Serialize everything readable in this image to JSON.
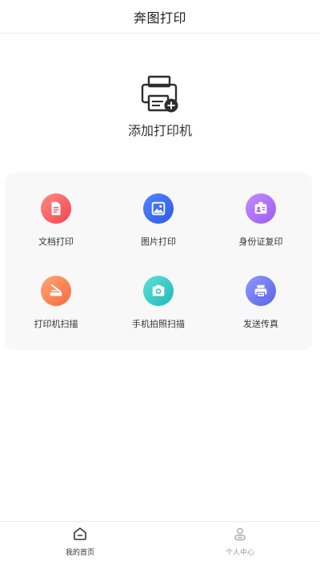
{
  "header": {
    "title": "奔图打印"
  },
  "add_printer": {
    "label": "添加打印机",
    "icon": "printer-add-icon"
  },
  "features": [
    {
      "id": "doc",
      "label": "文档打印",
      "icon": "document-icon",
      "gradient": [
        "#ff8a80",
        "#f4434f"
      ]
    },
    {
      "id": "image",
      "label": "图片打印",
      "icon": "image-icon",
      "gradient": [
        "#4f86ff",
        "#2f58e8"
      ]
    },
    {
      "id": "idcard",
      "label": "身份证复印",
      "icon": "id-card-icon",
      "gradient": [
        "#c58cff",
        "#9b5cf0"
      ]
    },
    {
      "id": "scan",
      "label": "打印机扫描",
      "icon": "scanner-icon",
      "gradient": [
        "#ffa475",
        "#f76c3e"
      ]
    },
    {
      "id": "photo",
      "label": "手机拍照扫描",
      "icon": "camera-icon",
      "gradient": [
        "#5ee0d8",
        "#1fb8b6"
      ]
    },
    {
      "id": "fax",
      "label": "发送传真",
      "icon": "fax-printer-icon",
      "gradient": [
        "#8f97ff",
        "#5b63e6"
      ]
    }
  ],
  "tabs": [
    {
      "label": "我的首页",
      "icon": "home-icon",
      "active": true
    },
    {
      "label": "个人中心",
      "icon": "user-icon",
      "active": false
    }
  ]
}
